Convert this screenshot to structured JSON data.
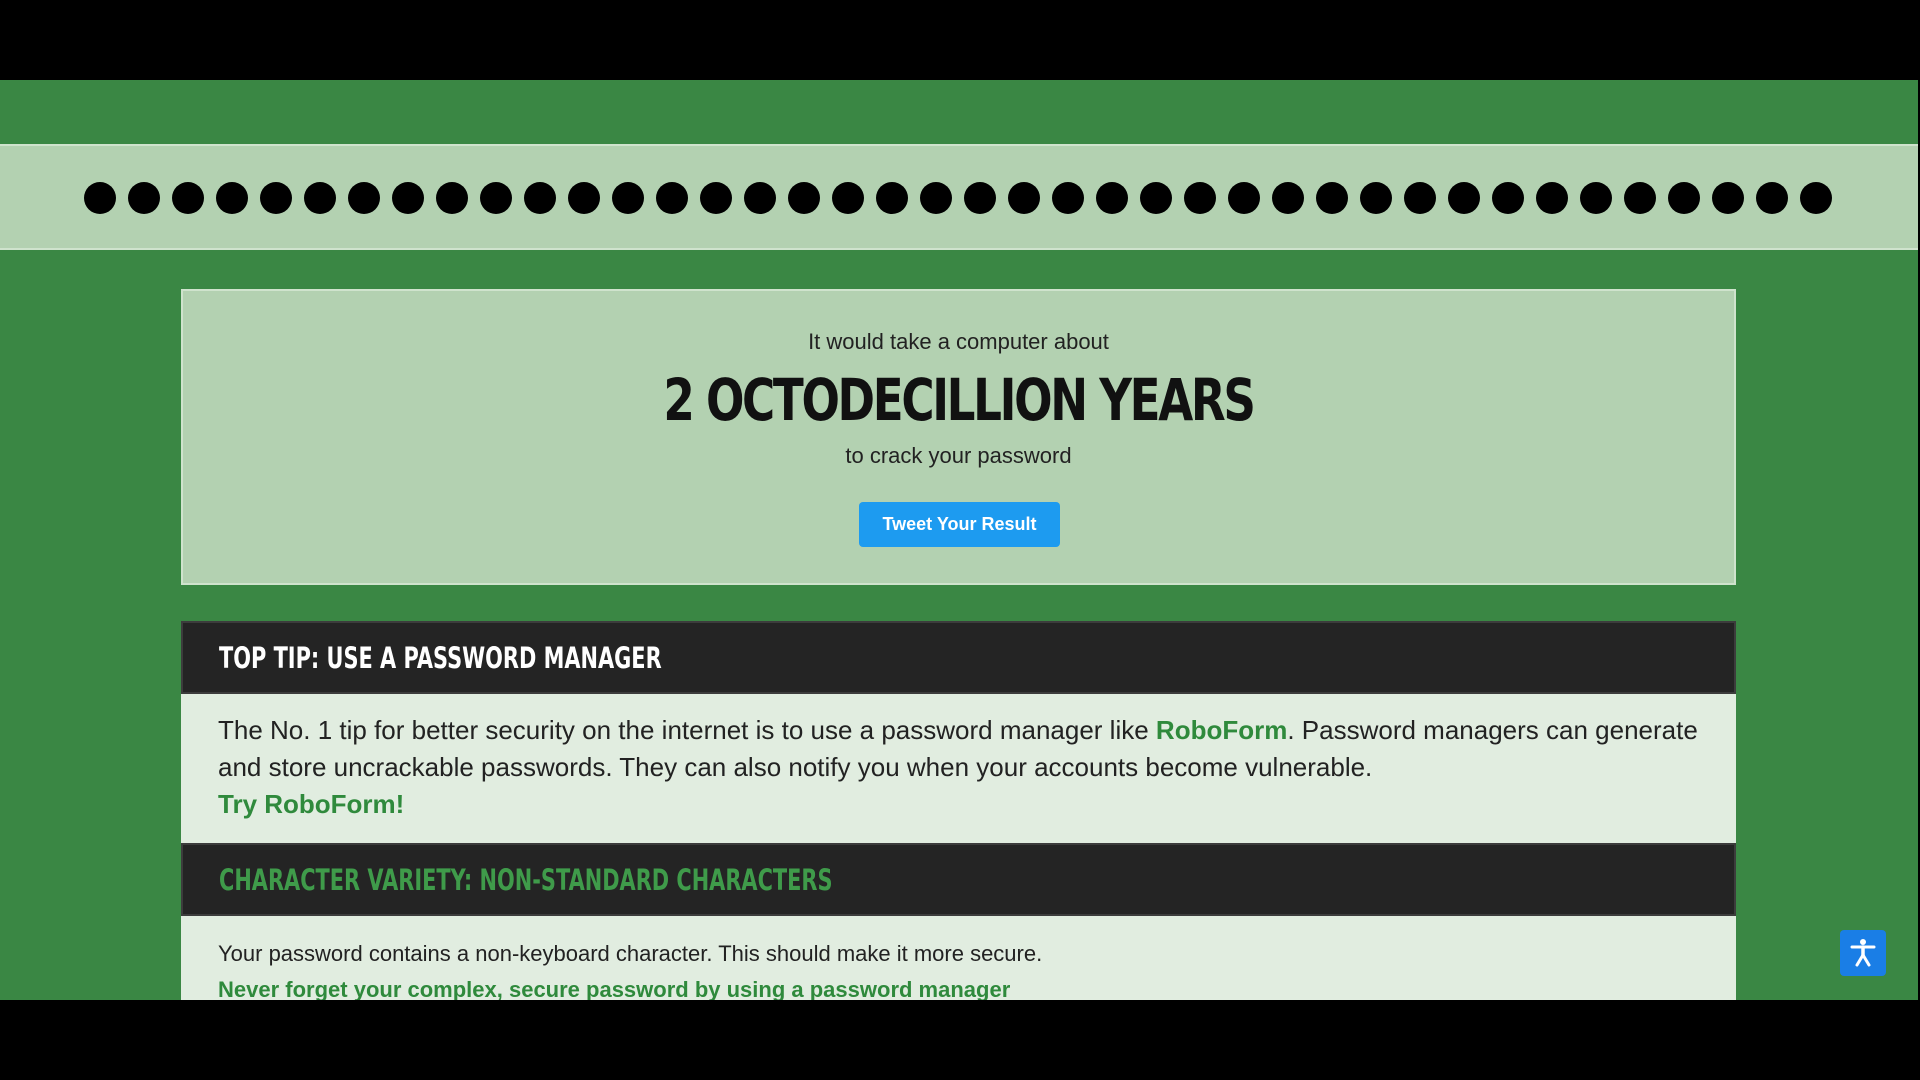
{
  "password": {
    "mask_length": 40
  },
  "result": {
    "intro": "It would take a computer about",
    "time": "2 OCTODECILLION YEARS",
    "outro": "to crack your password",
    "tweet_button": "Tweet Your Result"
  },
  "top_tip": {
    "title": "TOP TIP: USE A PASSWORD MANAGER",
    "text_before_link": "The No. 1 tip for better security on the internet is to use a password manager like ",
    "link": "RoboForm",
    "text_after_link": ". Password managers can generate and store uncrackable passwords. They can also notify you when your accounts become vulnerable.",
    "cta": "Try RoboForm!"
  },
  "character_variety": {
    "title": "CHARACTER VARIETY: NON-STANDARD CHARACTERS",
    "text": "Your password contains a non-keyboard character. This should make it more secure.",
    "cta": "Never forget your complex, secure password by using a password manager"
  },
  "accessibility": {
    "icon": "accessibility-icon"
  },
  "colors": {
    "page_green": "#3a8744",
    "panel_green": "#b3d1b1",
    "header_dark": "#242424",
    "link_green": "#2f8a3c",
    "tweet_blue": "#1d9bf0",
    "a11y_blue": "#1a7ee6"
  }
}
